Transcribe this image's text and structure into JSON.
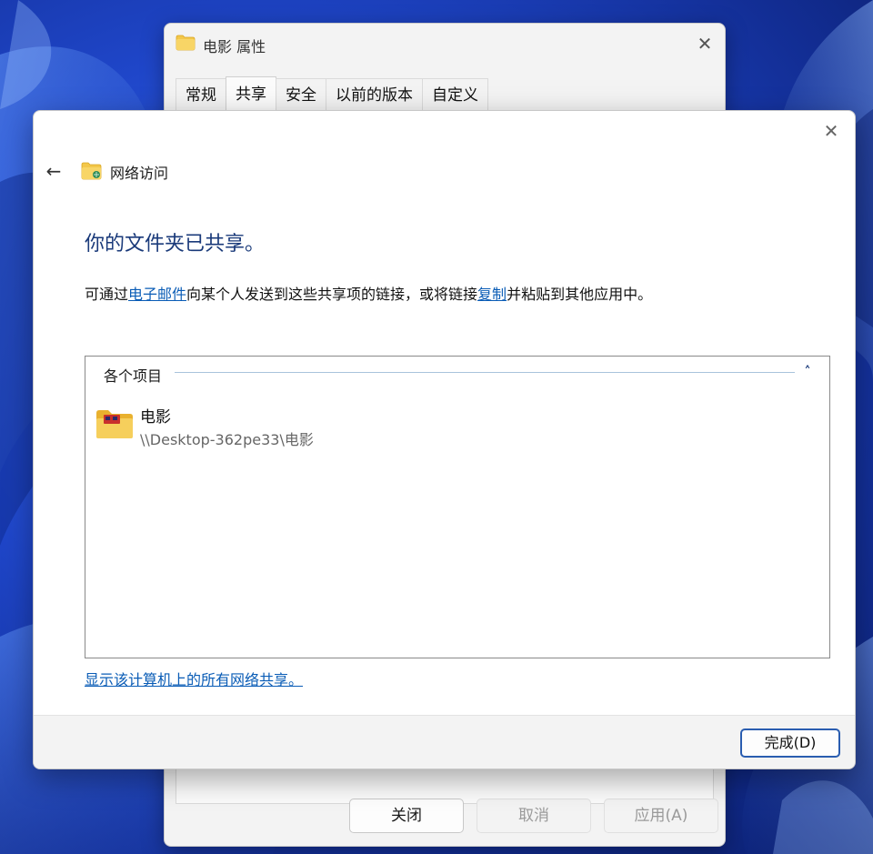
{
  "props_window": {
    "title": "电影 属性",
    "close_glyph": "✕",
    "tabs": [
      {
        "label": "常规"
      },
      {
        "label": "共享"
      },
      {
        "label": "安全"
      },
      {
        "label": "以前的版本"
      },
      {
        "label": "自定义"
      }
    ],
    "buttons": {
      "close": "关闭",
      "cancel": "取消",
      "apply": "应用(A)"
    }
  },
  "dialog": {
    "close_glyph": "✕",
    "back_glyph": "←",
    "header_title": "网络访问",
    "heading": "你的文件夹已共享。",
    "desc": {
      "part1": "可通过",
      "link_email": "电子邮件",
      "part2": "向某个人发送到这些共享项的链接，或将链接",
      "link_copy": "复制",
      "part3": "并粘贴到其他应用中。"
    },
    "items": {
      "header": "各个项目",
      "collapse_glyph": "˄",
      "list": [
        {
          "name": "电影",
          "path": "\\\\Desktop-362pe33\\电影"
        }
      ]
    },
    "show_all_link": "显示该计算机上的所有网络共享。",
    "done_button": "完成(D)"
  },
  "icons": {
    "folder": "folder-icon",
    "network_folder": "network-folder-icon",
    "shared_folder": "shared-folder-icon"
  },
  "colors": {
    "accent": "#2a5db0",
    "link": "#0a5cb6",
    "heading": "#1a3a7a",
    "folder": "#f3c74a"
  }
}
